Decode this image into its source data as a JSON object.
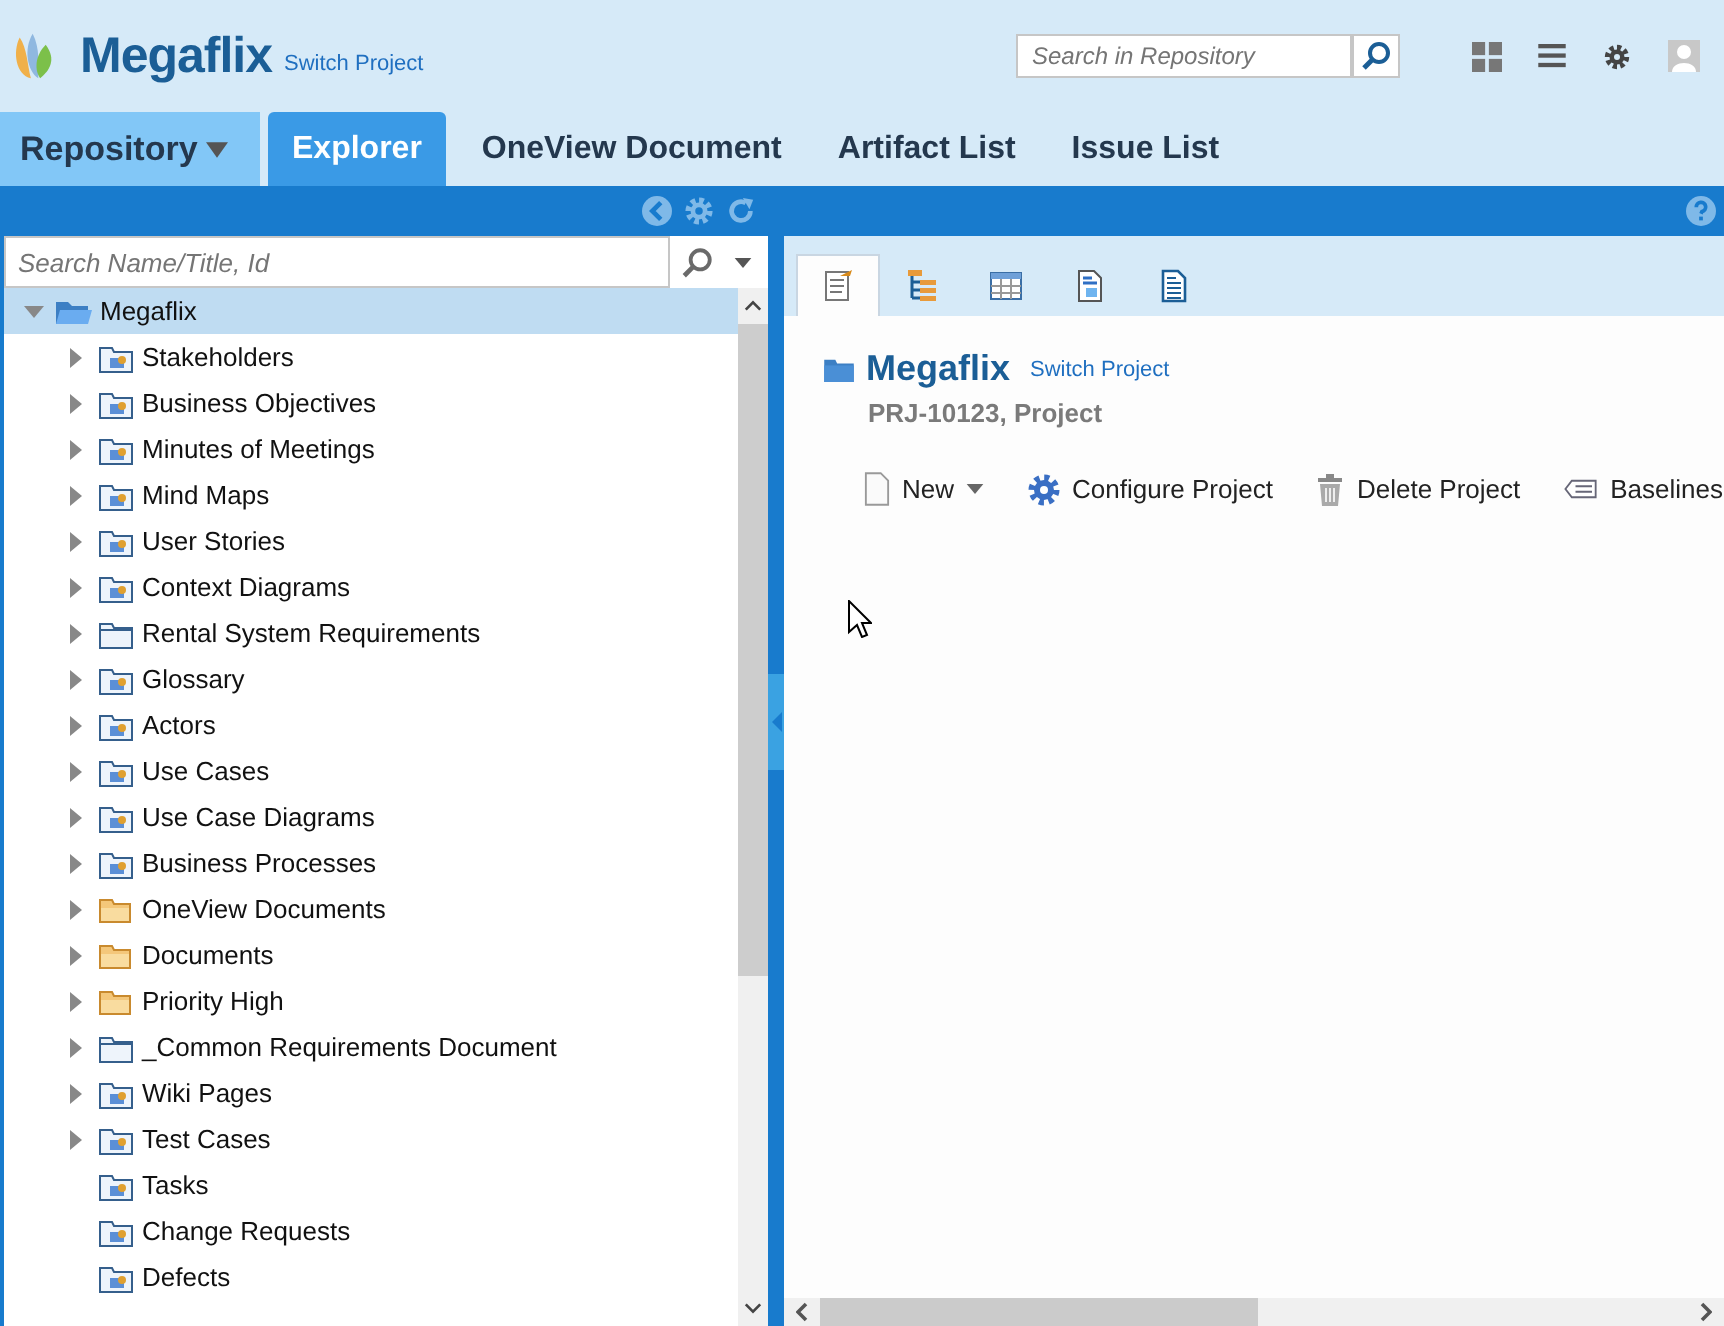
{
  "header": {
    "app_name": "Megaflix",
    "switch_link": "Switch Project",
    "search": {
      "placeholder": "Search in Repository"
    }
  },
  "nav_tabs": [
    {
      "label": "Repository",
      "kind": "menu",
      "selected": false
    },
    {
      "label": "Explorer",
      "kind": "tab",
      "selected": true
    },
    {
      "label": "OneView Document",
      "kind": "tab",
      "selected": false
    },
    {
      "label": "Artifact List",
      "kind": "tab",
      "selected": false
    },
    {
      "label": "Issue List",
      "kind": "tab",
      "selected": false
    }
  ],
  "tree_search": {
    "placeholder": "Search Name/Title, Id"
  },
  "tree": [
    {
      "label": "Megaflix",
      "kind": "project",
      "expanded": true,
      "selected": true,
      "children": [
        {
          "label": "Stakeholders",
          "kind": "artifact",
          "expandable": true,
          "selected": false
        },
        {
          "label": "Business Objectives",
          "kind": "artifact",
          "expandable": true,
          "selected": false
        },
        {
          "label": "Minutes of Meetings",
          "kind": "artifact",
          "expandable": true,
          "selected": false
        },
        {
          "label": "Mind Maps",
          "kind": "artifact",
          "expandable": true,
          "selected": false
        },
        {
          "label": "User Stories",
          "kind": "artifact",
          "expandable": true,
          "selected": false
        },
        {
          "label": "Context Diagrams",
          "kind": "artifact",
          "expandable": true,
          "selected": false
        },
        {
          "label": "Rental System Requirements",
          "kind": "folder",
          "expandable": true,
          "selected": false
        },
        {
          "label": "Glossary",
          "kind": "artifact",
          "expandable": true,
          "selected": false
        },
        {
          "label": "Actors",
          "kind": "artifact",
          "expandable": true,
          "selected": false
        },
        {
          "label": "Use Cases",
          "kind": "artifact",
          "expandable": true,
          "selected": false
        },
        {
          "label": "Use Case Diagrams",
          "kind": "artifact",
          "expandable": true,
          "selected": false
        },
        {
          "label": "Business Processes",
          "kind": "artifact",
          "expandable": true,
          "selected": false
        },
        {
          "label": "OneView Documents",
          "kind": "document-folder",
          "expandable": true,
          "selected": false
        },
        {
          "label": "Documents",
          "kind": "document-folder",
          "expandable": true,
          "selected": false
        },
        {
          "label": "Priority High",
          "kind": "document-folder",
          "expandable": true,
          "selected": false
        },
        {
          "label": "_Common Requirements Document",
          "kind": "folder",
          "expandable": true,
          "selected": false
        },
        {
          "label": "Wiki Pages",
          "kind": "artifact",
          "expandable": true,
          "selected": false
        },
        {
          "label": "Test Cases",
          "kind": "artifact",
          "expandable": true,
          "selected": false
        },
        {
          "label": "Tasks",
          "kind": "artifact",
          "expandable": false,
          "selected": false
        },
        {
          "label": "Change Requests",
          "kind": "artifact",
          "expandable": false,
          "selected": false
        },
        {
          "label": "Defects",
          "kind": "artifact",
          "expandable": false,
          "selected": false
        }
      ]
    }
  ],
  "view_tabs": [
    {
      "kind": "details",
      "selected": true
    },
    {
      "kind": "hierarchy",
      "selected": false
    },
    {
      "kind": "grid",
      "selected": false
    },
    {
      "kind": "document",
      "selected": false
    },
    {
      "kind": "text",
      "selected": false
    }
  ],
  "project": {
    "name": "Megaflix",
    "switch_link": "Switch Project",
    "subtitle": "PRJ-10123, Project"
  },
  "toolbar": [
    {
      "label": "New",
      "kind": "new"
    },
    {
      "label": "Configure Project",
      "kind": "configure"
    },
    {
      "label": "Delete Project",
      "kind": "delete"
    },
    {
      "label": "Baselines",
      "kind": "baselines"
    }
  ]
}
